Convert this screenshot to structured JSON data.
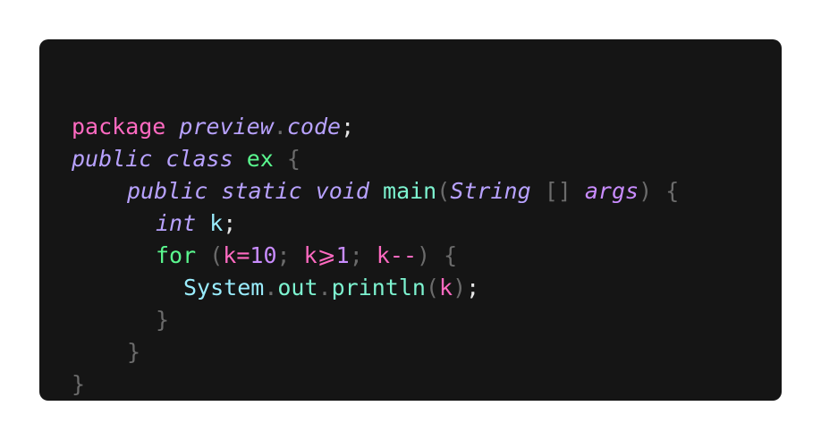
{
  "code": {
    "line1": {
      "t1": "package",
      "t2": " ",
      "t3": "preview",
      "t4": ".",
      "t5": "code",
      "t6": ";"
    },
    "line2": {
      "t1": "public",
      "t2": " ",
      "t3": "class",
      "t4": " ",
      "t5": "ex",
      "t6": " ",
      "t7": "{"
    },
    "line3": {
      "t1": "public",
      "t2": " ",
      "t3": "static",
      "t4": " ",
      "t5": "void",
      "t6": " ",
      "t7": "main",
      "t8": "(",
      "t9": "String",
      "t10": " ",
      "t11": "[]",
      "t12": " ",
      "t13": "args",
      "t14": ")",
      "t15": " ",
      "t16": "{"
    },
    "line4": {
      "t1": "int",
      "t2": " ",
      "t3": "k",
      "t4": ";"
    },
    "line5": {
      "t1": "for",
      "t2": " ",
      "t3": "(",
      "t4": "k",
      "t5": "=",
      "t6": "10",
      "t7": ";",
      "t8": " ",
      "t9": "k",
      "t10": "⩾",
      "t11": "1",
      "t12": ";",
      "t13": " ",
      "t14": "k",
      "t15": "--",
      "t16": ")",
      "t17": " ",
      "t18": "{"
    },
    "line6": {
      "t1": "System",
      "t2": ".",
      "t3": "out",
      "t4": ".",
      "t5": "println",
      "t6": "(",
      "t7": "k",
      "t8": ")",
      "t9": ";"
    },
    "line7": {
      "t1": "}"
    },
    "line8": {
      "t1": "}"
    },
    "line9": {
      "t1": "}"
    }
  },
  "colors": {
    "background": "#151515",
    "pink": "#ff6ac1",
    "lavender": "#b8a2ff",
    "green": "#5af78e",
    "cyan": "#9aedfe",
    "punctuation": "#6b6b6b"
  }
}
